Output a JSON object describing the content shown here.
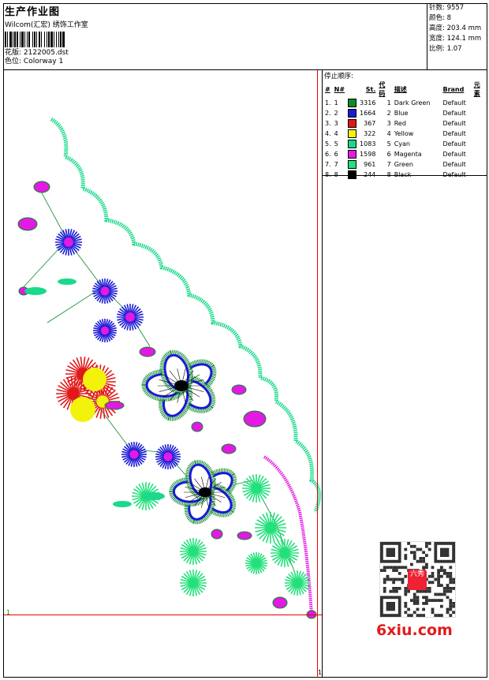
{
  "header": {
    "title": "生产作业图",
    "company": "Wilcom(汇宏) 绣饰工作室",
    "design_label": "花版:",
    "design_value": "2122005.dst",
    "colorway_label": "色位:",
    "colorway_value": "Colorway 1"
  },
  "stats": [
    {
      "label": "针数:",
      "value": "9557"
    },
    {
      "label": "颜色:",
      "value": "8"
    },
    {
      "label": "高度:",
      "value": "203.4 mm"
    },
    {
      "label": "宽度:",
      "value": "124.1 mm"
    },
    {
      "label": "比例:",
      "value": "1.07"
    }
  ],
  "stop_sequence": {
    "title": "停止顺序:",
    "columns": [
      "#",
      "N#",
      "St.",
      "代码",
      "描述",
      "Brand",
      "元素"
    ],
    "rows": [
      {
        "idx": "1.",
        "needle": "1",
        "color": "#0a8a2a",
        "stitches": "3316",
        "code": "1",
        "desc": "Dark Green",
        "brand": "Default"
      },
      {
        "idx": "2.",
        "needle": "2",
        "color": "#1a1ad6",
        "stitches": "1664",
        "code": "2",
        "desc": "Blue",
        "brand": "Default"
      },
      {
        "idx": "3.",
        "needle": "3",
        "color": "#e01818",
        "stitches": "367",
        "code": "3",
        "desc": "Red",
        "brand": "Default"
      },
      {
        "idx": "4.",
        "needle": "4",
        "color": "#f2f20a",
        "stitches": "322",
        "code": "4",
        "desc": "Yellow",
        "brand": "Default"
      },
      {
        "idx": "5.",
        "needle": "5",
        "color": "#19d98a",
        "stitches": "1083",
        "code": "5",
        "desc": "Cyan",
        "brand": "Default"
      },
      {
        "idx": "6.",
        "needle": "6",
        "color": "#e21ae2",
        "stitches": "1598",
        "code": "6",
        "desc": "Magenta",
        "brand": "Default"
      },
      {
        "idx": "7.",
        "needle": "7",
        "color": "#22e07a",
        "stitches": "961",
        "code": "7",
        "desc": "Green",
        "brand": "Default"
      },
      {
        "idx": "8.",
        "needle": "8",
        "color": "#000000",
        "stitches": "244",
        "code": "8",
        "desc": "Black",
        "brand": "Default"
      }
    ]
  },
  "canvas": {
    "origin_mark": "1",
    "corner_mark": "1"
  },
  "watermark": {
    "site": "6xiu.com",
    "stamp_text": "六秀"
  }
}
